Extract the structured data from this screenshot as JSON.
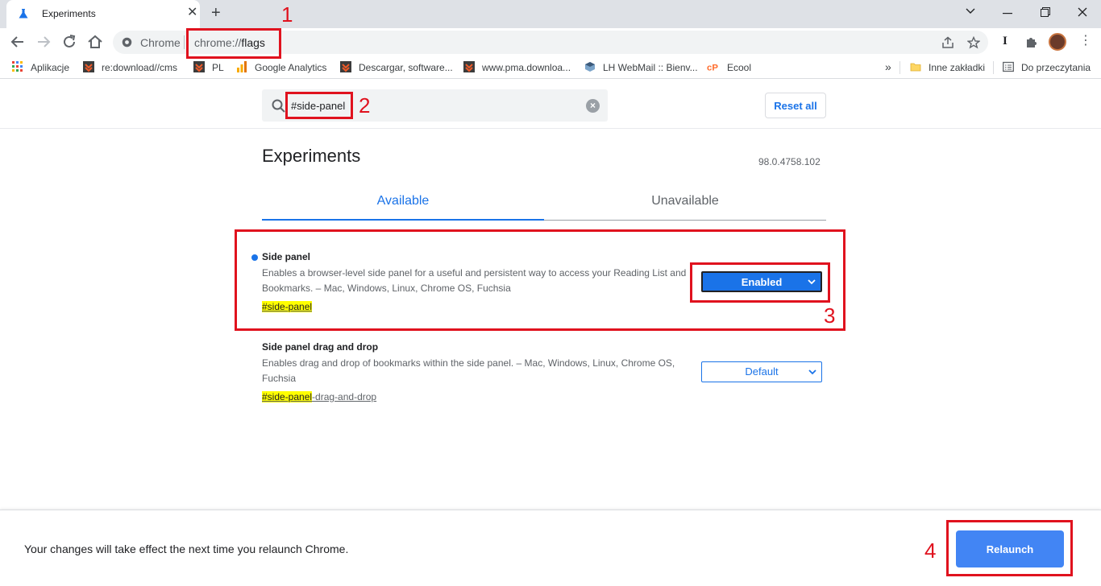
{
  "browser": {
    "tab_title": "Experiments",
    "site_chip": "Chrome",
    "url_prefix": "chrome://",
    "url_host": "flags"
  },
  "bookmarks": [
    {
      "label": "Aplikacje",
      "icon": "apps-grid-icon"
    },
    {
      "label": "re:download//cms",
      "icon": "shield-icon"
    },
    {
      "label": "PL",
      "icon": "shield-icon"
    },
    {
      "label": "Google Analytics",
      "icon": "analytics-icon"
    },
    {
      "label": "Descargar, software...",
      "icon": "shield-icon"
    },
    {
      "label": "www.pma.downloa...",
      "icon": "shield-icon"
    },
    {
      "label": "LH WebMail :: Bienv...",
      "icon": "webmail-icon"
    },
    {
      "label": "Ecool",
      "icon": "cpanel-icon"
    }
  ],
  "bookmarks_right": {
    "more": "»",
    "other": "Inne zakładki",
    "reading": "Do przeczytania"
  },
  "search": {
    "value": "#side-panel",
    "reset_label": "Reset all"
  },
  "page": {
    "title": "Experiments",
    "version": "98.0.4758.102",
    "tabs": [
      {
        "label": "Available",
        "active": true
      },
      {
        "label": "Unavailable",
        "active": false
      }
    ]
  },
  "flags": [
    {
      "title": "Side panel",
      "description": "Enables a browser-level side panel for a useful and persistent way to access your Reading List and Bookmarks. – Mac, Windows, Linux, Chrome OS, Fuchsia",
      "link_match": "#side-panel",
      "link_rest": "",
      "state": "Enabled"
    },
    {
      "title": "Side panel drag and drop",
      "description": "Enables drag and drop of bookmarks within the side panel. – Mac, Windows, Linux, Chrome OS, Fuchsia",
      "link_match": "#side-panel",
      "link_rest": "-drag-and-drop",
      "state": "Default"
    }
  ],
  "footer": {
    "message": "Your changes will take effect the next time you relaunch Chrome.",
    "relaunch_label": "Relaunch"
  },
  "annotations": [
    "1",
    "2",
    "3",
    "4"
  ],
  "colors": {
    "accent": "#1a73e8",
    "relaunch": "#4285f4",
    "callout": "#e0121e",
    "highlight": "#ffff00"
  }
}
